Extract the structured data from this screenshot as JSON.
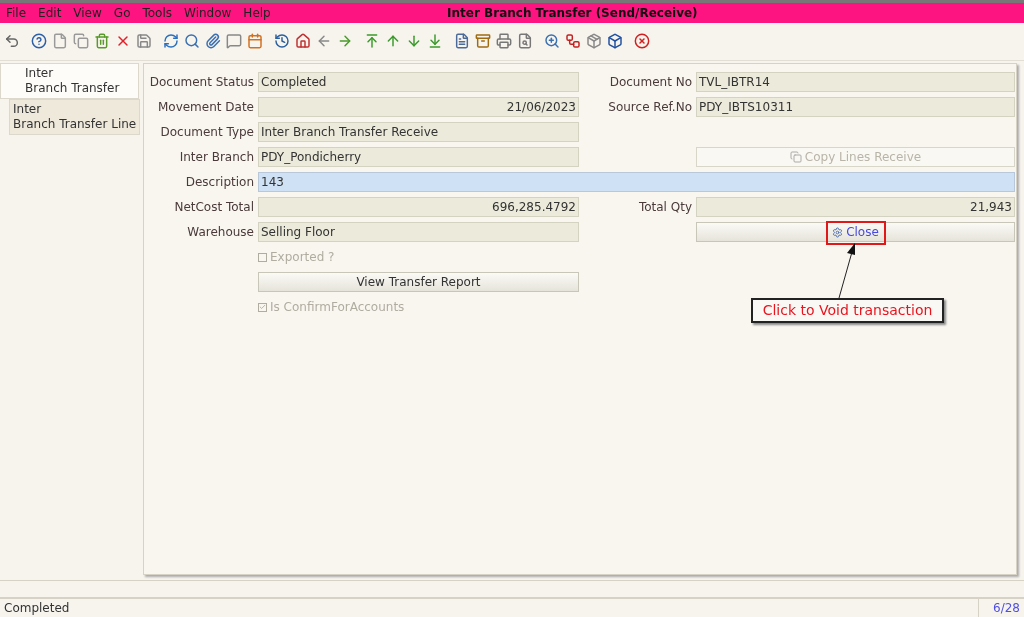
{
  "window": {
    "title": "Inter Branch Transfer (Send/Receive)"
  },
  "menu": [
    {
      "label": "File"
    },
    {
      "label": "Edit"
    },
    {
      "label": "View"
    },
    {
      "label": "Go"
    },
    {
      "label": "Tools"
    },
    {
      "label": "Window"
    },
    {
      "label": "Help"
    }
  ],
  "tabs": [
    {
      "label": "Inter\nBranch Transfer",
      "selected": true
    },
    {
      "label": "Inter\nBranch Transfer Line",
      "selected": false
    }
  ],
  "rows": [
    {
      "kind": "pair",
      "left": {
        "kind": "field",
        "label": "Document Status",
        "value": "Completed"
      },
      "right": {
        "kind": "field",
        "label": "Document No",
        "value": "TVL_IBTR14"
      }
    },
    {
      "kind": "pair",
      "left": {
        "kind": "field",
        "label": "Movement Date",
        "value": "21/06/2023",
        "numeric": true
      },
      "right": {
        "kind": "field",
        "label": "Source Ref.No",
        "value": "PDY_IBTS10311"
      }
    },
    {
      "kind": "pair",
      "left": {
        "kind": "field",
        "label": "Document Type",
        "value": "Inter Branch Transfer Receive"
      }
    },
    {
      "kind": "pair",
      "left": {
        "kind": "field",
        "label": "Inter Branch",
        "value": "PDY_Pondicherry"
      },
      "right": {
        "kind": "button",
        "label": "Copy Lines Receive",
        "disabled": true,
        "highlighted": false
      }
    },
    {
      "kind": "wide",
      "field": {
        "kind": "field",
        "label": "Description",
        "value": "143",
        "focused": true
      }
    },
    {
      "kind": "pair",
      "left": {
        "kind": "field",
        "label": "NetCost Total",
        "value": "696,285.4792",
        "numeric": true
      },
      "right": {
        "kind": "field",
        "label": "Total Qty",
        "value": "21,943",
        "numeric": true
      }
    },
    {
      "kind": "pair",
      "left": {
        "kind": "field",
        "label": "Warehouse",
        "value": "Selling Floor"
      },
      "right": {
        "kind": "button",
        "label": "Close",
        "disabled": false,
        "highlighted": true
      }
    },
    {
      "kind": "pair",
      "left": {
        "kind": "checkbox",
        "label": "Exported ?",
        "checked": false,
        "disabled": true
      }
    },
    {
      "kind": "pair",
      "left": {
        "kind": "button",
        "label": "View Transfer Report",
        "disabled": false,
        "highlighted": false
      }
    },
    {
      "kind": "pair",
      "left": {
        "kind": "checkbox",
        "label": "Is ConfirmForAccounts",
        "checked": true,
        "disabled": true
      }
    }
  ],
  "annotation": {
    "text": "Click to Void transaction"
  },
  "status_bar": {
    "message": "Completed",
    "record": "6/28"
  }
}
